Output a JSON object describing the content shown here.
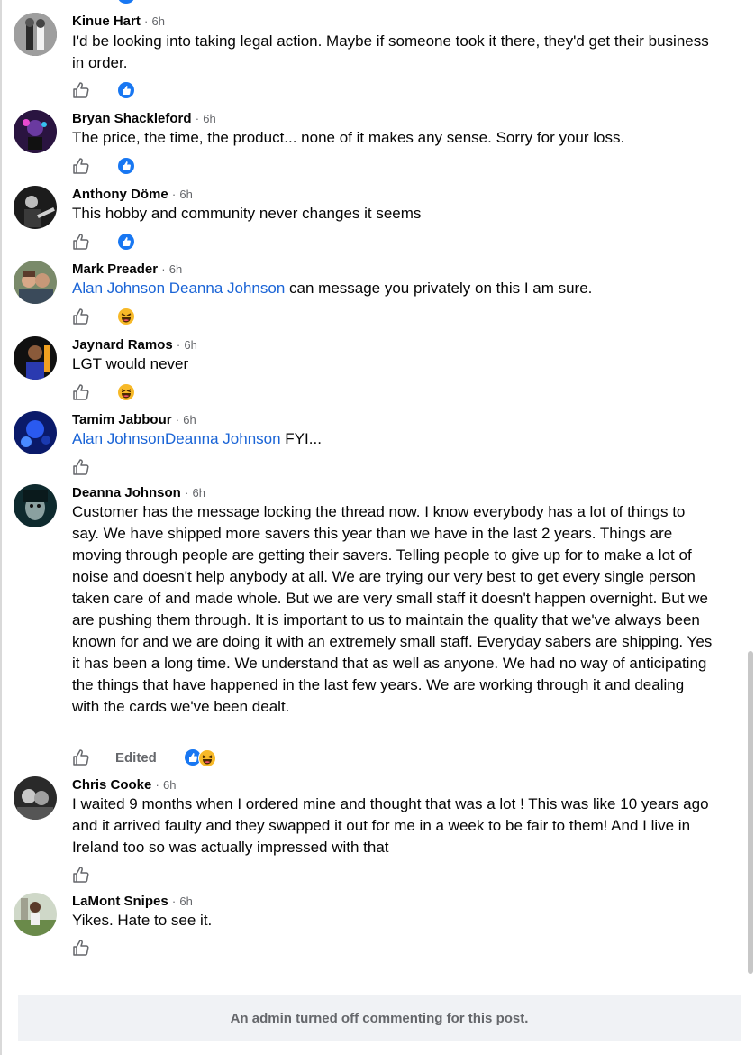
{
  "comments": [
    {
      "author": "Kinue Hart",
      "time": "6h",
      "text_plain": "I'd be looking into taking legal action. Maybe if someone took it there, they'd get their business in order.",
      "reaction": "like"
    },
    {
      "author": "Bryan Shackleford",
      "time": "6h",
      "text_plain": "The price, the time, the product... none of it makes any sense. Sorry for your loss.",
      "reaction": "like"
    },
    {
      "author": "Anthony Döme",
      "time": "6h",
      "text_plain": "This hobby and community never changes it seems",
      "reaction": "like"
    },
    {
      "author": "Mark Preader",
      "time": "6h",
      "mention": "Alan Johnson Deanna Johnson",
      "text_after_mention": " can message you privately on this I am sure.",
      "reaction": "haha"
    },
    {
      "author": "Jaynard Ramos",
      "time": "6h",
      "text_plain": "LGT would never",
      "reaction": "haha"
    },
    {
      "author": "Tamim Jabbour",
      "time": "6h",
      "mention": "Alan JohnsonDeanna Johnson",
      "text_after_mention": " FYI...",
      "reaction": "none"
    },
    {
      "author": "Deanna Johnson",
      "time": "6h",
      "text_plain": "Customer has the message locking the thread now. I know everybody has a lot of things to say. We have shipped more savers this year than we have in the last 2 years. Things are moving through people are getting their savers. Telling people to give up for to make a lot of noise and doesn't help anybody at all. We are trying our very best to get every single person taken care of and made whole. But we are very small staff it doesn't happen overnight. But we are pushing them through. It is important to us to maintain the quality that we've always been known for and we are doing it with an extremely small staff. Everyday sabers are shipping. Yes it has been a long time. We understand that as well as anyone. We had no way of anticipating the things that have happened in the last few years. We are working through it and dealing with the cards we've been dealt.",
      "edited_label": "Edited",
      "reaction": "like+haha"
    },
    {
      "author": "Chris Cooke",
      "time": "6h",
      "text_plain": "I waited 9 months when I ordered mine and thought that was a lot ! This was like 10 years ago and it arrived faulty and they swapped it out for me in a week to be fair to them! And I live in Ireland too so was actually impressed with that",
      "reaction": "none"
    },
    {
      "author": "LaMont Snipes",
      "time": "6h",
      "text_plain": "Yikes. Hate to see it.",
      "reaction": "none"
    }
  ],
  "separator": "·",
  "footer_text": "An admin turned off commenting for this post.",
  "colors": {
    "accent_blue": "#1877f2",
    "mention_blue": "#1a64d6",
    "secondary_text": "#65676b",
    "footer_bg": "#f0f2f5"
  },
  "icons": {
    "like_button": "thumbs-up-outline-icon",
    "like_reaction": "blue-thumbs-up-icon",
    "haha_reaction": "laughing-face-icon"
  }
}
